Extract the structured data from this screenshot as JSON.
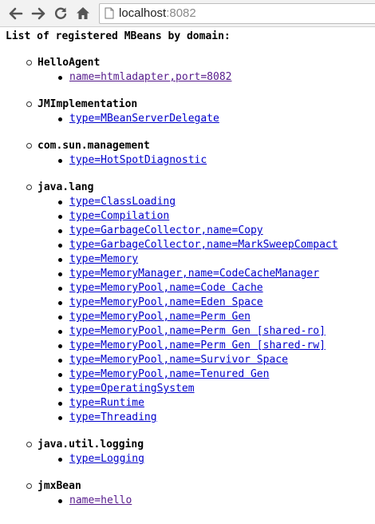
{
  "browser": {
    "url_host": "localhost",
    "url_port": ":8082",
    "icons": [
      "back-arrow-icon",
      "forward-arrow-icon",
      "reload-icon",
      "home-icon",
      "page-icon"
    ]
  },
  "page": {
    "heading": "List of registered MBeans by domain:",
    "link_color": "#0000cc",
    "visited_link_color": "#551a8b"
  },
  "domains": [
    {
      "name": "HelloAgent",
      "mbeans": [
        {
          "label": "name=htmladapter,port=8082",
          "visited": true
        }
      ]
    },
    {
      "name": "JMImplementation",
      "mbeans": [
        {
          "label": "type=MBeanServerDelegate",
          "visited": false
        }
      ]
    },
    {
      "name": "com.sun.management",
      "mbeans": [
        {
          "label": "type=HotSpotDiagnostic",
          "visited": false
        }
      ]
    },
    {
      "name": "java.lang",
      "mbeans": [
        {
          "label": "type=ClassLoading",
          "visited": false
        },
        {
          "label": "type=Compilation",
          "visited": false
        },
        {
          "label": "type=GarbageCollector,name=Copy",
          "visited": false
        },
        {
          "label": "type=GarbageCollector,name=MarkSweepCompact",
          "visited": false
        },
        {
          "label": "type=Memory",
          "visited": false
        },
        {
          "label": "type=MemoryManager,name=CodeCacheManager",
          "visited": false
        },
        {
          "label": "type=MemoryPool,name=Code Cache",
          "visited": false
        },
        {
          "label": "type=MemoryPool,name=Eden Space",
          "visited": false
        },
        {
          "label": "type=MemoryPool,name=Perm Gen",
          "visited": false
        },
        {
          "label": "type=MemoryPool,name=Perm Gen [shared-ro]",
          "visited": false
        },
        {
          "label": "type=MemoryPool,name=Perm Gen [shared-rw]",
          "visited": false
        },
        {
          "label": "type=MemoryPool,name=Survivor Space",
          "visited": false
        },
        {
          "label": "type=MemoryPool,name=Tenured Gen",
          "visited": false
        },
        {
          "label": "type=OperatingSystem",
          "visited": false
        },
        {
          "label": "type=Runtime",
          "visited": false
        },
        {
          "label": "type=Threading",
          "visited": false
        }
      ]
    },
    {
      "name": "java.util.logging",
      "mbeans": [
        {
          "label": "type=Logging",
          "visited": false
        }
      ]
    },
    {
      "name": "jmxBean",
      "mbeans": [
        {
          "label": "name=hello",
          "visited": true
        }
      ]
    }
  ]
}
